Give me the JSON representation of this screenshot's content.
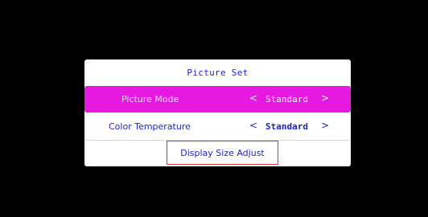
{
  "dialog": {
    "title": "Picture Set",
    "rows": [
      {
        "label": "Picture Mode",
        "value": "Standard",
        "prev_glyph": "<",
        "next_glyph": ">"
      },
      {
        "label": "Color Temperature",
        "value": "Standard",
        "prev_glyph": "<",
        "next_glyph": ">"
      }
    ],
    "action_label": "Display Size Adjust"
  },
  "colors": {
    "background": "#000000",
    "dialog_background": "#ffffff",
    "highlight": "#e619e0",
    "text_accent": "#1b1fd6",
    "focus_border": "#e03030"
  }
}
